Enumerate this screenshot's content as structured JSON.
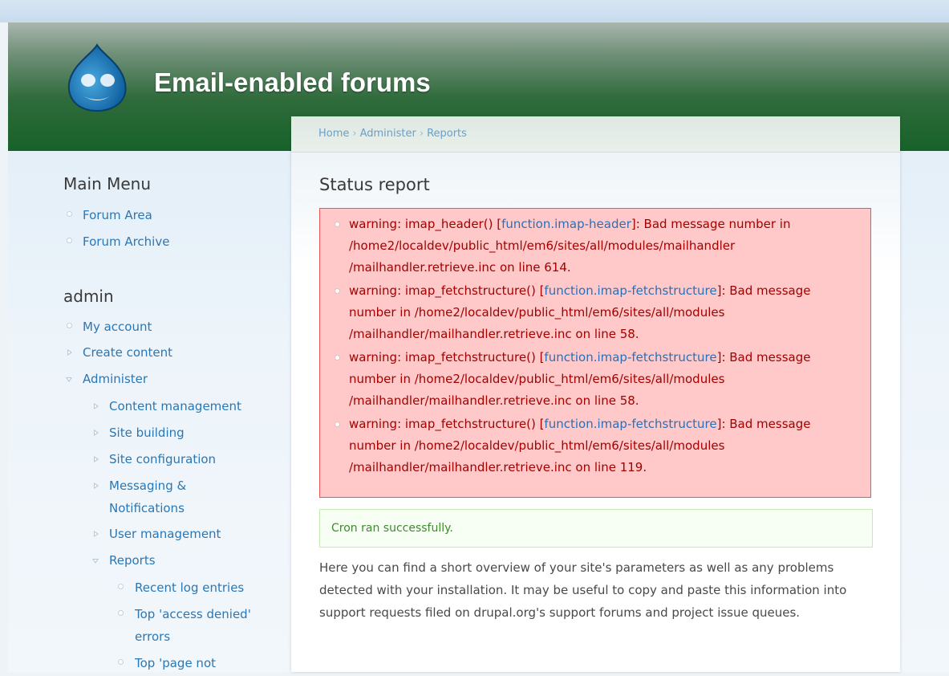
{
  "site": {
    "name": "Email-enabled forums"
  },
  "breadcrumb": {
    "items": [
      "Home",
      "Administer",
      "Reports"
    ],
    "separator": "›"
  },
  "page": {
    "title": "Status report"
  },
  "errors": [
    {
      "prefix": "warning: imap_header() [",
      "link": "function.imap-header",
      "suffix": "]: Bad message number in /home2/localdev/public_html/em6/sites/all/modules/mailhandler /mailhandler.retrieve.inc on line 614."
    },
    {
      "prefix": "warning: imap_fetchstructure() [",
      "link": "function.imap-fetchstructure",
      "suffix": "]: Bad message number in /home2/localdev/public_html/em6/sites/all/modules /mailhandler/mailhandler.retrieve.inc on line 58."
    },
    {
      "prefix": "warning: imap_fetchstructure() [",
      "link": "function.imap-fetchstructure",
      "suffix": "]: Bad message number in /home2/localdev/public_html/em6/sites/all/modules /mailhandler/mailhandler.retrieve.inc on line 58."
    },
    {
      "prefix": "warning: imap_fetchstructure() [",
      "link": "function.imap-fetchstructure",
      "suffix": "]: Bad message number in /home2/localdev/public_html/em6/sites/all/modules /mailhandler/mailhandler.retrieve.inc on line 119."
    }
  ],
  "status_message": "Cron ran successfully.",
  "intro": "Here you can find a short overview of your site's parameters as well as any problems detected with your installation. It may be useful to copy and paste this information into support requests filed on drupal.org's support forums and project issue queues.",
  "main_menu": {
    "title": "Main Menu",
    "items": [
      "Forum Area",
      "Forum Archive"
    ]
  },
  "admin_menu": {
    "title": "admin",
    "my_account": "My account",
    "create_content": "Create content",
    "administer": "Administer",
    "content_management": "Content management",
    "site_building": "Site building",
    "site_configuration": "Site configuration",
    "messaging_line1": "Messaging &",
    "messaging_line2": "Notifications",
    "user_management": "User management",
    "reports": "Reports",
    "recent_log": "Recent log entries",
    "access_denied_line1": "Top 'access denied'",
    "access_denied_line2": "errors",
    "page_not_found_line1": "Top 'page not"
  },
  "colors": {
    "header_green": "#17622a",
    "link": "#2a77b5",
    "error_text": "#a30000",
    "error_bg": "#ffc9c9",
    "status_text": "#3f8a2f"
  }
}
